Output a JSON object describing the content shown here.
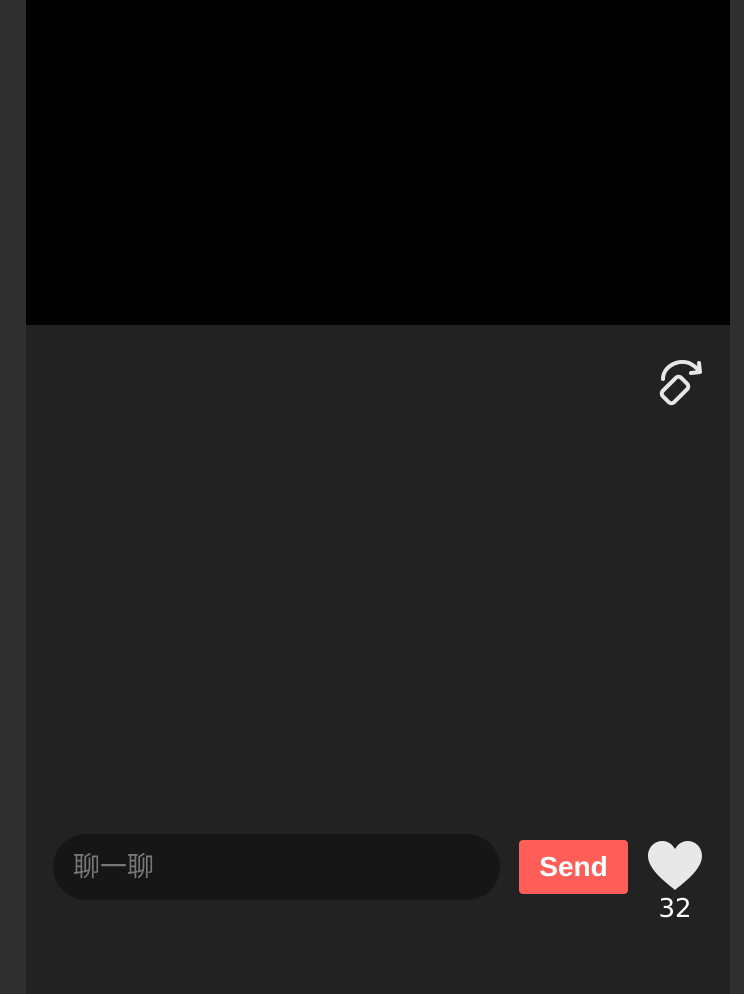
{
  "player": {
    "rotate_icon": "rotate-screen-icon"
  },
  "chat": {
    "placeholder": "聊一聊",
    "value": ""
  },
  "send_button": {
    "label": "Send",
    "color": "#fe5d58"
  },
  "like": {
    "icon": "heart-icon",
    "count": "32"
  },
  "colors": {
    "page_background": "#222222",
    "video_background": "#000000",
    "input_background": "#161616"
  }
}
